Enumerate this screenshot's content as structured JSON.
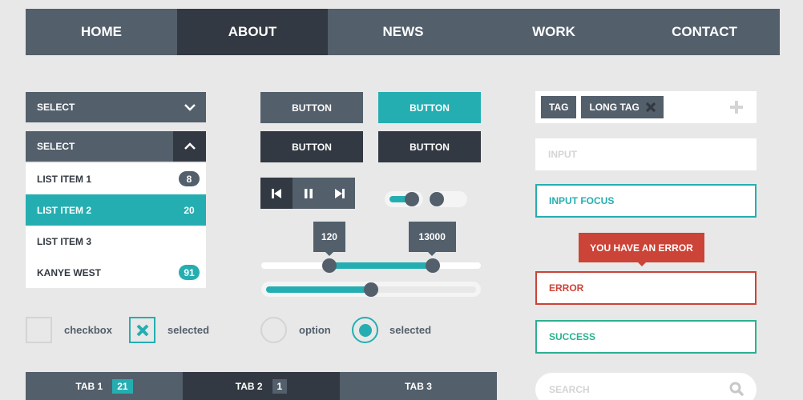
{
  "colors": {
    "background": "#e8e8e8",
    "primary": "#535f6b",
    "dark": "#333942",
    "accent": "#25aeb1",
    "error": "#cc4337",
    "success": "#2bb090",
    "muted": "#d4d4d4"
  },
  "nav": {
    "items": [
      {
        "label": "HOME",
        "active": false
      },
      {
        "label": "ABOUT",
        "active": true
      },
      {
        "label": "NEWS",
        "active": false
      },
      {
        "label": "WORK",
        "active": false
      },
      {
        "label": "CONTACT",
        "active": false
      }
    ]
  },
  "select_closed": {
    "label": "SELECT",
    "icon": "chevron-down-icon"
  },
  "select_open": {
    "label": "SELECT",
    "icon": "chevron-up-icon",
    "items": [
      {
        "label": "LIST ITEM 1",
        "badge": "8",
        "active": false
      },
      {
        "label": "LIST ITEM 2",
        "badge": "20",
        "active": true
      },
      {
        "label": "LIST ITEM 3",
        "badge": "",
        "active": false
      },
      {
        "label": "KANYE WEST",
        "badge": "91",
        "active": false
      }
    ]
  },
  "checkboxes": [
    {
      "label": "checkbox",
      "checked": false
    },
    {
      "label": "selected",
      "checked": true
    }
  ],
  "buttons": [
    {
      "label": "BUTTON",
      "style": "default"
    },
    {
      "label": "BUTTON",
      "style": "accent"
    },
    {
      "label": "BUTTON",
      "style": "dark"
    },
    {
      "label": "BUTTON",
      "style": "dark"
    }
  ],
  "media_controls": [
    "skip-back-icon",
    "pause-icon",
    "skip-forward-icon"
  ],
  "toggles": [
    {
      "state": "on"
    },
    {
      "state": "off"
    }
  ],
  "range_slider": {
    "low_label": "120",
    "high_label": "13000",
    "low_fraction": 0.31,
    "high_fraction": 0.78
  },
  "progress_slider": {
    "fraction": 0.5
  },
  "radios": [
    {
      "label": "option",
      "selected": false
    },
    {
      "label": "selected",
      "selected": true
    }
  ],
  "tabs": [
    {
      "label": "TAB 1",
      "count": "21",
      "active": false
    },
    {
      "label": "TAB 2",
      "count": "1",
      "active": true
    },
    {
      "label": "TAB 3",
      "count": "",
      "active": false
    }
  ],
  "tags": {
    "items": [
      "TAG",
      "LONG TAG"
    ],
    "add_icon": "plus-icon",
    "remove_icon": "close-icon"
  },
  "inputs": {
    "placeholder": "INPUT",
    "focus_value": "INPUT FOCUS",
    "error_tooltip": "YOU HAVE AN ERROR",
    "error_value": "ERROR",
    "success_value": "SUCCESS",
    "search_placeholder": "SEARCH"
  }
}
